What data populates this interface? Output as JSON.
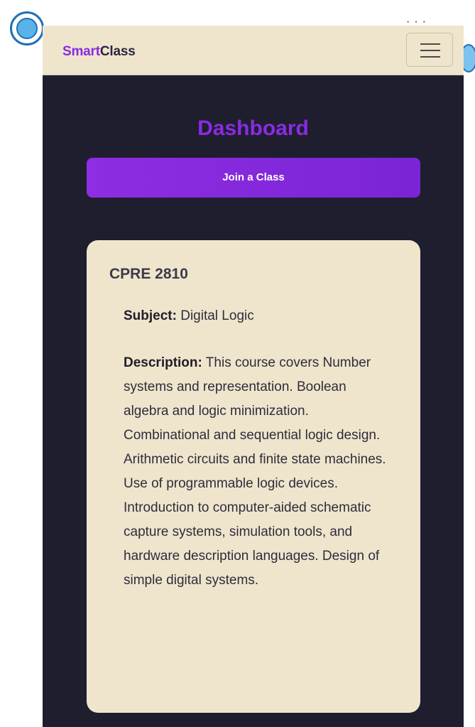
{
  "navbar": {
    "brand_part1": "Smart",
    "brand_part2": "Class",
    "menu_icon": "hamburger-menu-icon"
  },
  "dashboard": {
    "title": "Dashboard",
    "join_button_label": "Join a Class"
  },
  "course_card": {
    "name": "CPRE 2810",
    "subject_label": "Subject:",
    "subject_value": "Digital Logic",
    "description_label": "Description:",
    "description_value": "This course covers Number systems and representation. Boolean algebra and logic minimization. Combinational and sequential logic design. Arithmetic circuits and finite state machines. Use of programmable logic devices. Introduction to computer-aided schematic capture systems, simulation tools, and hardware description languages. Design of simple digital systems."
  },
  "colors": {
    "accent": "#8a2be2",
    "navbar_bg": "#efe5cd",
    "page_bg": "#1e1e2f",
    "card_bg": "#efe5cd"
  }
}
